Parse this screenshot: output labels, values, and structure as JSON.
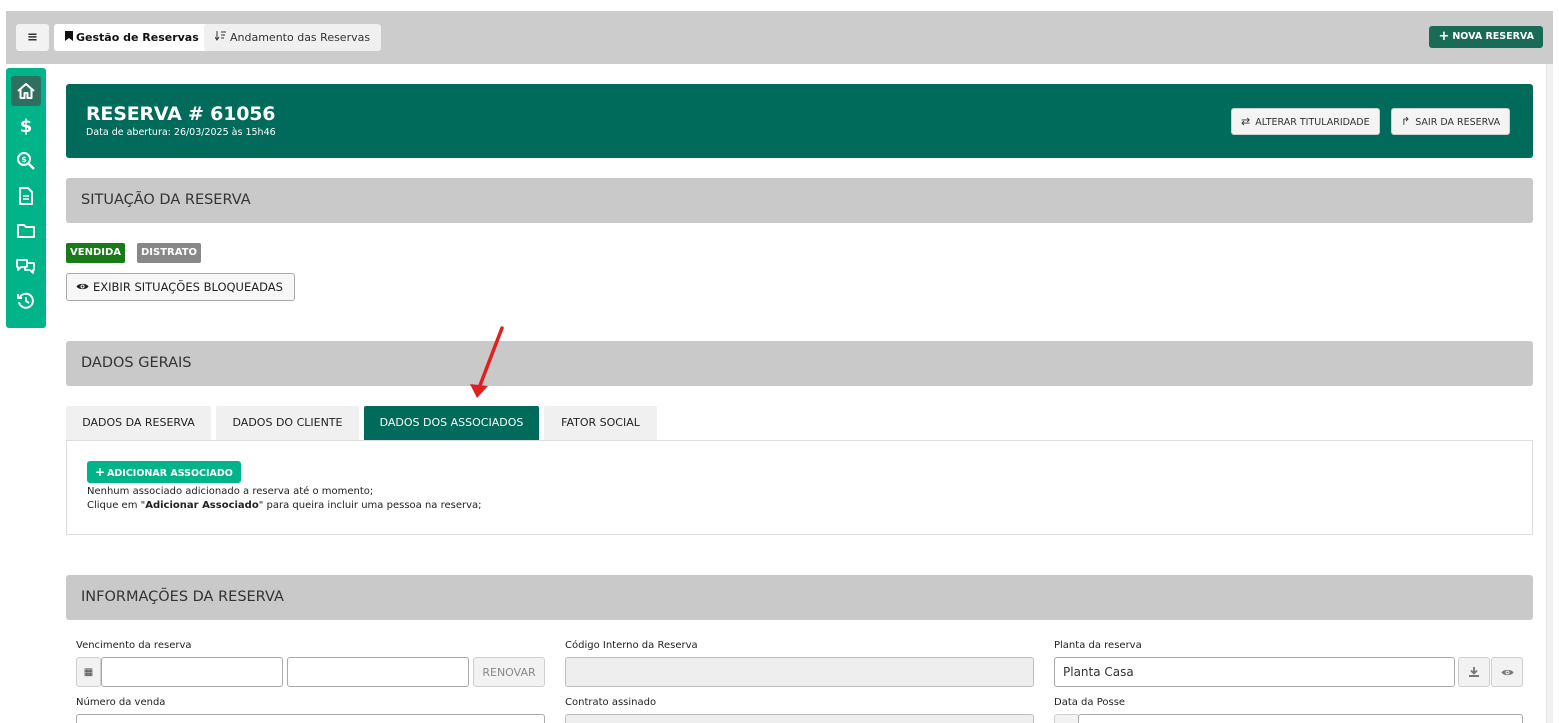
{
  "topbar": {
    "menu_icon": "≡",
    "tabs": [
      {
        "label": "Gestão de Reservas",
        "icon": "bookmark-icon"
      },
      {
        "label": "Andamento das Reservas",
        "icon": "sort-icon"
      }
    ],
    "new_button": "NOVA RESERVA"
  },
  "sidenav": {
    "items": [
      "home-icon",
      "dollar-icon",
      "search-dollar-icon",
      "document-icon",
      "folder-icon",
      "chat-icon",
      "history-icon"
    ]
  },
  "header": {
    "title": "RESERVA # 61056",
    "subtitle": "Data de abertura: 26/03/2025 às 15h46",
    "alterar_label": "ALTERAR TITULARIDADE",
    "sair_label": "SAIR DA RESERVA"
  },
  "situacao": {
    "title": "SITUAÇÃO DA RESERVA",
    "badges": [
      {
        "label": "VENDIDA",
        "color": "#1a7a1a"
      },
      {
        "label": "DISTRATO",
        "color": "#888888"
      }
    ],
    "exibir_label": "EXIBIR SITUAÇÕES BLOQUEADAS"
  },
  "dados_gerais": {
    "title": "DADOS GERAIS",
    "tabs": [
      "DADOS DA RESERVA",
      "DADOS DO CLIENTE",
      "DADOS DOS ASSOCIADOS",
      "FATOR SOCIAL"
    ],
    "active_tab": "DADOS DOS ASSOCIADOS",
    "add_button": "ADICIONAR ASSOCIADO",
    "msg1": "Nenhum associado adicionado a reserva até o momento;",
    "msg2_pre": "Clique em \"",
    "msg2_bold": "Adicionar Associado",
    "msg2_post": "\" para queira incluir uma pessoa na reserva;"
  },
  "informacoes": {
    "title": "INFORMAÇÕES DA RESERVA",
    "vencimento_label": "Vencimento da reserva",
    "renovar_label": "RENOVAR",
    "codigo_label": "Código Interno da Reserva",
    "planta_label": "Planta da reserva",
    "planta_value": "Planta Casa",
    "numero_label": "Número da venda",
    "contrato_label": "Contrato assinado",
    "posse_label": "Data da Posse"
  },
  "colors": {
    "primary_dark": "#006b5a",
    "accent": "#00b48a",
    "section_bg": "#c9c9c9",
    "annotation_arrow": "#e02020"
  }
}
